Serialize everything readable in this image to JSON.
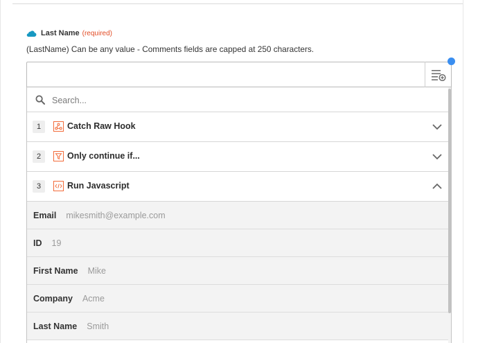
{
  "field": {
    "label": "Last Name",
    "required_text": "(required)",
    "help_text": "(LastName) Can be any value - Comments fields are capped at 250 characters.",
    "value": ""
  },
  "dropdown": {
    "search_placeholder": "Search...",
    "steps": [
      {
        "number": "1",
        "title": "Catch Raw Hook",
        "expanded": false
      },
      {
        "number": "2",
        "title": "Only continue if...",
        "expanded": false
      },
      {
        "number": "3",
        "title": "Run Javascript",
        "expanded": true
      }
    ],
    "fields": [
      {
        "key": "Email",
        "value": "mikesmith@example.com"
      },
      {
        "key": "ID",
        "value": "19"
      },
      {
        "key": "First Name",
        "value": "Mike"
      },
      {
        "key": "Company",
        "value": "Acme"
      },
      {
        "key": "Last Name",
        "value": "Smith"
      }
    ]
  },
  "colors": {
    "accent_blue": "#3a8ef0",
    "required_red": "#e24b24",
    "salesforce_blue": "#1798c1",
    "step_icon_orange": "#f26b3a"
  },
  "icons": {
    "field_app": "salesforce-cloud-icon",
    "insert": "insert-data-icon",
    "search": "search-icon",
    "step1": "webhook-icon",
    "step2": "filter-icon",
    "step3": "code-icon"
  }
}
